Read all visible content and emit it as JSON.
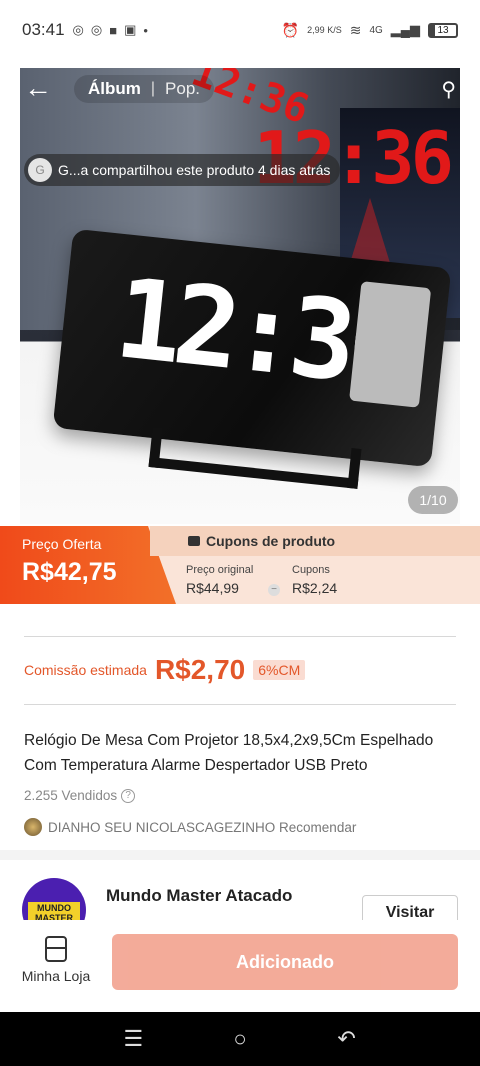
{
  "status": {
    "time": "03:41",
    "speed": "2,99 K/S",
    "network": "4G",
    "battery": "13"
  },
  "gallery": {
    "tab_album": "Álbum",
    "tab_pop": "Pop.",
    "separator": "|",
    "share_avatar_letter": "G",
    "share_text": "G...a compartilhou este produto 4 dias atrás",
    "page_indicator": "1/10",
    "clock_display": "12:36"
  },
  "price": {
    "offer_label": "Preço Oferta",
    "offer_price": "R$42,75",
    "coupons_header": "Cupons de produto",
    "original_label": "Preço original",
    "original_value": "R$44,99",
    "coupon_label": "Cupons",
    "coupon_value": "R$2,24"
  },
  "details": {
    "commission_label": "Comissão estimada",
    "commission_value": "R$2,70",
    "commission_badge": "6%CM",
    "title": "Relógio De Mesa Com Projetor 18,5x4,2x9,5Cm Espelhado Com Temperatura Alarme Despertador USB Preto",
    "sold": "2.255 Vendidos",
    "recommender": "DIANHO SEU NICOLASCAGEZINHO Recomendar"
  },
  "store": {
    "logo_text": "MUNDO MASTER",
    "name": "Mundo Master Atacado",
    "visit_label": "Visitar"
  },
  "actions": {
    "my_store_label": "Minha Loja",
    "add_label": "Adicionado"
  }
}
